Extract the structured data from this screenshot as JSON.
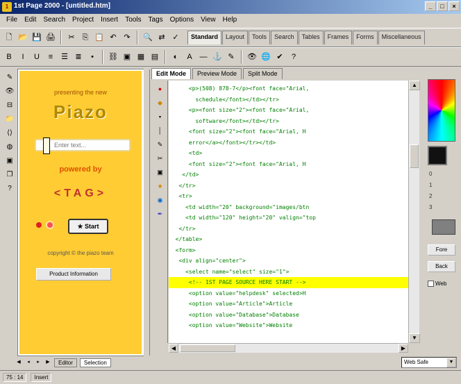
{
  "window": {
    "title": "1st Page 2000 - [untitled.htm]"
  },
  "menu": [
    "File",
    "Edit",
    "Search",
    "Project",
    "Insert",
    "Tools",
    "Tags",
    "Options",
    "View",
    "Help"
  ],
  "toolbar1": {
    "icons": [
      "new-file-icon",
      "open-icon",
      "save-icon",
      "print-icon",
      "cut-icon",
      "copy-icon",
      "paste-icon",
      "undo-icon",
      "redo-icon",
      "find-icon",
      "replace-icon",
      "spellcheck-icon"
    ],
    "glyphs": [
      "🗋",
      "📂",
      "💾",
      "🖨",
      "✂",
      "⎘",
      "📋",
      "↶",
      "↷",
      "🔍",
      "⇄",
      "✓"
    ],
    "tabs": [
      "Standard",
      "Layout",
      "Tools",
      "Search",
      "Tables",
      "Frames",
      "Forms",
      "Miscellaneous"
    ],
    "active_tab": 0
  },
  "toolbar2": {
    "icons": [
      "bold-icon",
      "italic-icon",
      "underline-icon",
      "align-left-icon",
      "align-center-icon",
      "align-right-icon",
      "list-icon",
      "link-icon",
      "image-icon",
      "table-icon",
      "form-icon",
      "color-icon",
      "font-icon",
      "hr-icon",
      "anchor-icon",
      "comment-icon",
      "preview-icon",
      "browser-icon",
      "validate-icon",
      "help-icon"
    ],
    "glyphs": [
      "B",
      "I",
      "U",
      "≡",
      "☰",
      "≣",
      "•",
      "⛓",
      "▣",
      "▦",
      "▤",
      "◐",
      "A",
      "—",
      "⚓",
      "✎",
      "👁",
      "🌐",
      "✔",
      "?"
    ]
  },
  "left_icons": [
    "Editor",
    "Preview",
    "Split",
    "Files",
    "Tags",
    "Colors",
    "Images",
    "Snippets",
    "Help"
  ],
  "preview": {
    "tagline": "presenting the new",
    "logo": "Piazo",
    "input_placeholder": "Enter text...",
    "powered": "powered by",
    "brand": "<TAG>",
    "start_label": "Start",
    "copyright": "copyright © the piazo team",
    "info_label": "Product Information"
  },
  "doc_tabs": [
    "Edit Mode",
    "Preview Mode",
    "Split Mode"
  ],
  "active_doc_tab": 0,
  "code_lines": [
    "      <p>(508) 878-7</p><font face=\"Arial,",
    "        schedule</font></td></tr>",
    "      <p><font size=\"2\"><font face=\"Arial,",
    "        software</font></td></tr>",
    "      <font size=\"2\"><font face=\"Arial, H",
    "      error</a></font></tr></td>",
    "      <td>",
    "      <font size=\"2\"><font face=\"Arial, H",
    "    </td>",
    "   </tr>",
    "   <tr>",
    "     <td width=\"20\" background=\"images/btn",
    "     <td width=\"120\" height=\"20\" valign=\"top",
    "   </tr>",
    "  </table>",
    "  <form>",
    "   <div align=\"center\">",
    "     <select name=\"select\" size=\"1\">",
    "      <!-- 1ST PAGE SOURCE HERE START -->",
    "      <option value=\"helpdesk\" selected>H",
    "      <option value=\"Article\">Article",
    "      <option value=\"Database\">Database",
    "      <option value=\"Website\">Website"
  ],
  "highlight_line": 18,
  "right_panel": {
    "labels": [
      "0",
      "1",
      "2",
      "3"
    ],
    "buttons": [
      "Fore",
      "Back"
    ],
    "check_label": "Web"
  },
  "bottom_tabs": [
    "Editor",
    "Selection"
  ],
  "active_bottom_tab": 1,
  "status": [
    "75 : 14",
    "Insert"
  ],
  "dropdown_value": "Web Safe"
}
